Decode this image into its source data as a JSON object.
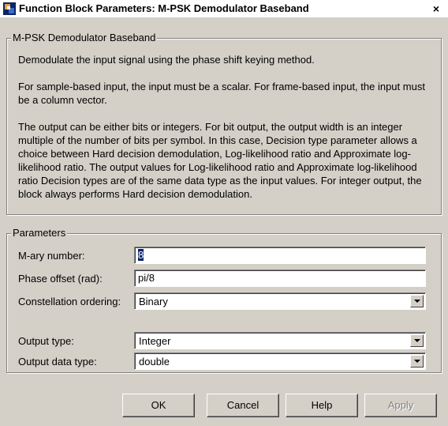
{
  "window": {
    "title": "Function Block Parameters: M-PSK Demodulator Baseband",
    "close_label": "×"
  },
  "description": {
    "group_title": "M-PSK Demodulator Baseband",
    "paragraphs": [
      "Demodulate the input signal using the phase shift keying method.",
      "For sample-based input, the input must be a scalar. For frame-based input, the input must be a column vector.",
      "The output can be either bits or integers. For bit output, the output width is an integer multiple of the number of bits per symbol. In this case, Decision type parameter allows a choice between Hard decision demodulation, Log-likelihood ratio and Approximate log-likelihood ratio. The output values for Log-likelihood ratio and Approximate log-likelihood ratio Decision types are of the same data type as the input values. For integer output, the block always performs Hard decision demodulation."
    ]
  },
  "parameters": {
    "group_title": "Parameters",
    "mary_label": "M-ary number:",
    "mary_value": "8",
    "phase_label": "Phase offset (rad):",
    "phase_value": "pi/8",
    "ordering_label": "Constellation ordering:",
    "ordering_value": "Binary",
    "output_type_label": "Output type:",
    "output_type_value": "Integer",
    "output_dtype_label": "Output data type:",
    "output_dtype_value": "double"
  },
  "buttons": {
    "ok": "OK",
    "cancel": "Cancel",
    "help": "Help",
    "apply": "Apply"
  }
}
